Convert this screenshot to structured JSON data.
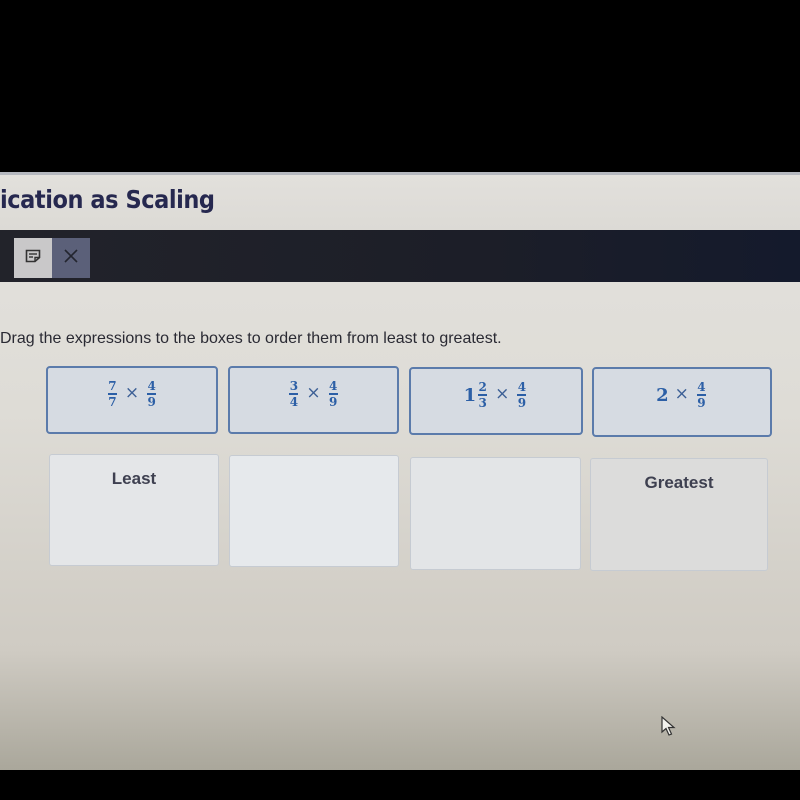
{
  "page": {
    "title": "ication as Scaling"
  },
  "toolbar": {
    "notes_icon": "notes-icon",
    "close_icon": "close-icon"
  },
  "question": {
    "instructions": "Drag the expressions to the boxes to order them from least to greatest."
  },
  "tiles": [
    {
      "whole": "",
      "a_num": "7",
      "a_den": "7",
      "op": "×",
      "b_num": "4",
      "b_den": "9",
      "label": "7/7 × 4/9"
    },
    {
      "whole": "",
      "a_num": "3",
      "a_den": "4",
      "op": "×",
      "b_num": "4",
      "b_den": "9",
      "label": "3/4 × 4/9"
    },
    {
      "whole": "1",
      "a_num": "2",
      "a_den": "3",
      "op": "×",
      "b_num": "4",
      "b_den": "9",
      "label": "1 2/3 × 4/9"
    },
    {
      "whole": "2",
      "a_num": "",
      "a_den": "",
      "op": "×",
      "b_num": "4",
      "b_den": "9",
      "label": "2 × 4/9"
    }
  ],
  "drop_boxes": [
    {
      "label": "Least"
    },
    {
      "label": ""
    },
    {
      "label": ""
    },
    {
      "label": "Greatest"
    }
  ],
  "colors": {
    "title": "#26284f",
    "toolbar_bg": "#1c1e28",
    "tile_border": "#5b7bab",
    "tile_text": "#2c5fa6"
  }
}
